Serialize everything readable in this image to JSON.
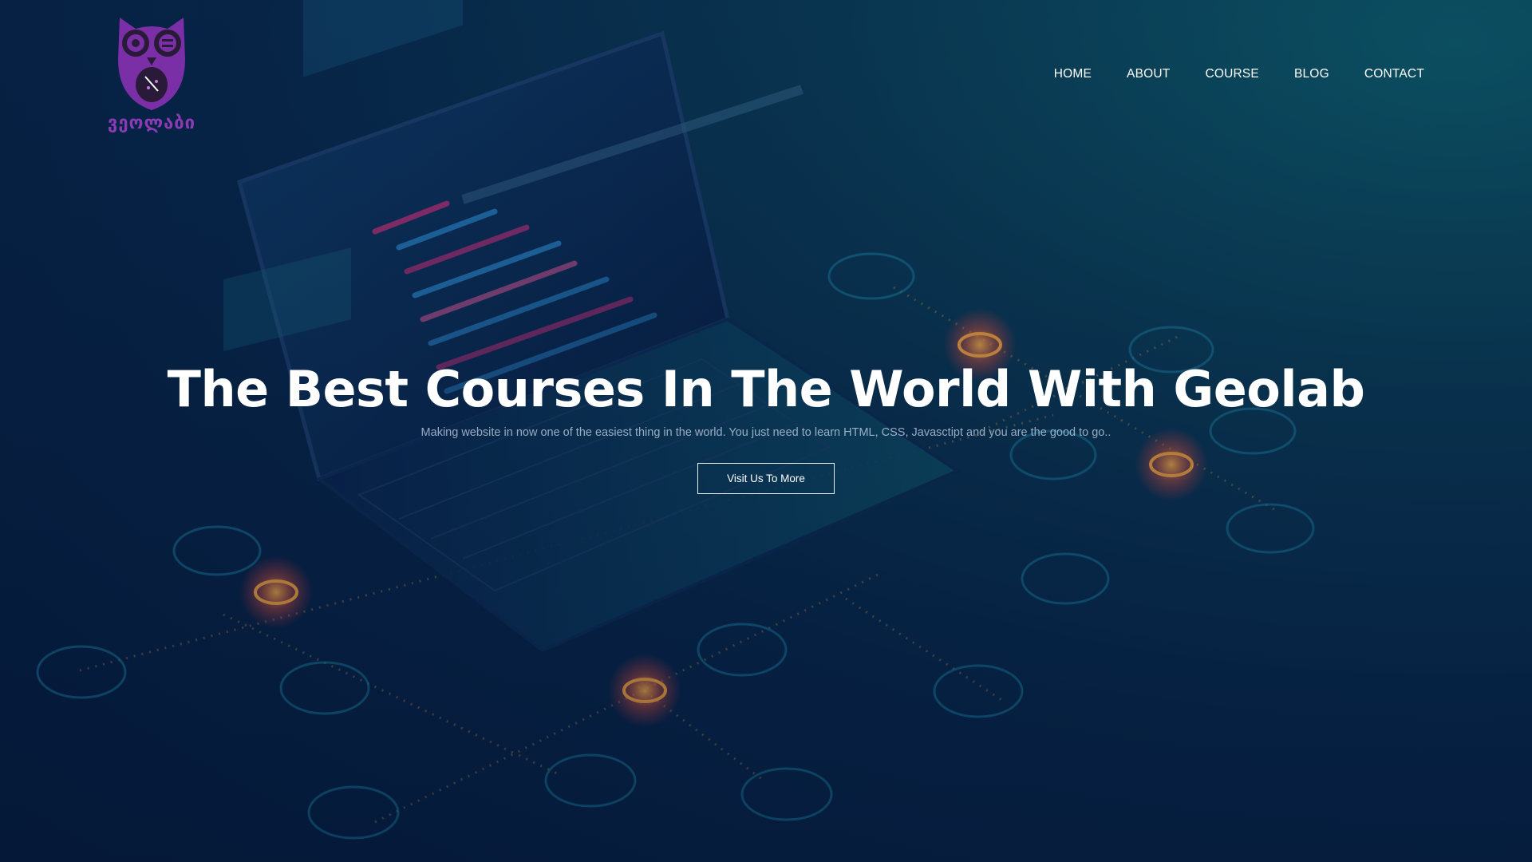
{
  "brand": {
    "logo_text": "ვეოლაბი",
    "logo_color": "#8a3bb5"
  },
  "nav": {
    "items": [
      {
        "label": "HOME"
      },
      {
        "label": "ABOUT"
      },
      {
        "label": "COURSE"
      },
      {
        "label": "BLOG"
      },
      {
        "label": "CONTACT"
      }
    ]
  },
  "hero": {
    "title": "The Best Courses In The World With Geolab",
    "subtitle": "Making website in now one of the easiest thing in the world. You just need to learn HTML, CSS, Javasctipt and you are the good to go..",
    "cta_label": "Visit Us To More"
  },
  "colors": {
    "background_dark": "#051b3d",
    "background_accent": "#0d5a6a",
    "highlight_orange": "#f0a040",
    "highlight_red": "#ff3b4a",
    "line_teal": "#1fa7b8"
  },
  "illustration": {
    "icons": [
      "calendar-icon",
      "send-icon",
      "people-icon",
      "cloud-icon",
      "location-icon",
      "wifi-icon",
      "chart-icon",
      "document-icon",
      "shield-icon",
      "chat-icon",
      "camera-icon",
      "pin-icon",
      "mail-icon",
      "list-icon"
    ]
  }
}
